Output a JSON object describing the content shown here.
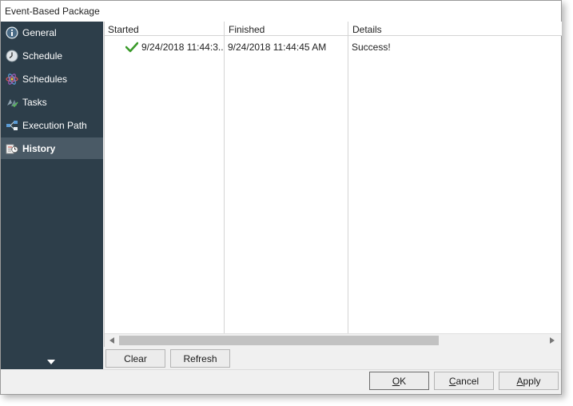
{
  "window": {
    "title": "Event-Based Package"
  },
  "sidebar": {
    "items": [
      {
        "label": "General",
        "icon": "info-icon",
        "active": false
      },
      {
        "label": "Schedule",
        "icon": "clock-icon",
        "active": false
      },
      {
        "label": "Schedules",
        "icon": "atom-icon",
        "active": false
      },
      {
        "label": "Tasks",
        "icon": "tasks-icon",
        "active": false
      },
      {
        "label": "Execution Path",
        "icon": "execution-path-icon",
        "active": false
      },
      {
        "label": "History",
        "icon": "history-icon",
        "active": true
      }
    ]
  },
  "history_table": {
    "columns": [
      "Started",
      "Finished",
      "Details"
    ],
    "rows": [
      {
        "status_icon": "success-check-icon",
        "started": "9/24/2018 11:44:3...",
        "finished": "9/24/2018 11:44:45 AM",
        "details": "Success!"
      }
    ]
  },
  "actions": {
    "clear_label": "Clear",
    "refresh_label": "Refresh"
  },
  "dialog_buttons": {
    "ok_label": "OK",
    "ok_mnemonic": "O",
    "ok_rest": "K",
    "cancel_label": "Cancel",
    "cancel_mnemonic": "C",
    "cancel_rest": "ancel",
    "apply_label": "Apply",
    "apply_mnemonic": "A",
    "apply_rest": "pply"
  },
  "colors": {
    "sidebar_bg": "#2d3e4a",
    "sidebar_active": "#4a5a66",
    "success_green": "#3a9a2a"
  }
}
